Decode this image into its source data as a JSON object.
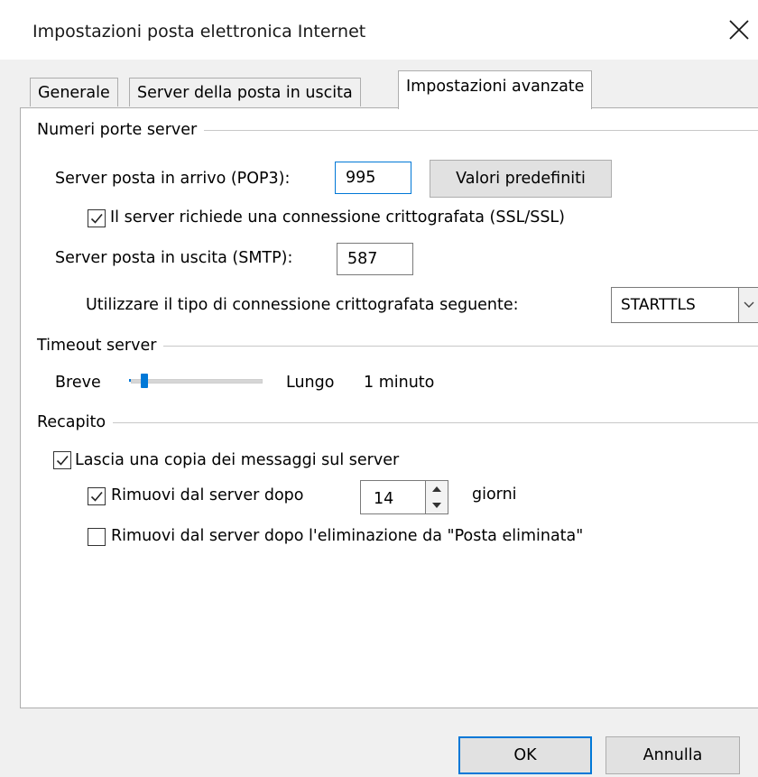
{
  "window": {
    "title": "Impostazioni posta elettronica Internet",
    "close_icon": "close-icon"
  },
  "tabs": [
    {
      "label": "Generale",
      "active": false
    },
    {
      "label": "Server della posta in uscita",
      "active": false
    },
    {
      "label": "Impostazioni avanzate",
      "active": true
    }
  ],
  "ports": {
    "header": "Numeri porte server",
    "incoming_label": "Server posta in arrivo (POP3):",
    "incoming_value": "995",
    "defaults_button": "Valori predefiniti",
    "ssl_checkbox_label": "Il server richiede una connessione crittografata (SSL/SSL)",
    "ssl_checked": true,
    "outgoing_label": "Server posta in uscita (SMTP):",
    "outgoing_value": "587",
    "encryption_label": "Utilizzare il tipo di connessione crittografata seguente:",
    "encryption_value": "STARTTLS"
  },
  "timeout": {
    "header": "Timeout server",
    "short_label": "Breve",
    "long_label": "Lungo",
    "value_label": "1 minuto",
    "slider_fraction": 0.08
  },
  "delivery": {
    "header": "Recapito",
    "leave_copy_label": "Lascia una copia dei messaggi sul server",
    "leave_copy_checked": true,
    "remove_after_label": "Rimuovi dal server dopo",
    "remove_after_checked": true,
    "days_value": "14",
    "days_label": "giorni",
    "remove_deleted_label": "Rimuovi dal server dopo l'eliminazione da \"Posta eliminata\"",
    "remove_deleted_checked": false
  },
  "buttons": {
    "ok": "OK",
    "cancel": "Annulla"
  },
  "colors": {
    "accent": "#0078d7",
    "dialog_bg": "#f0f0f0",
    "panel_bg": "#ffffff"
  }
}
